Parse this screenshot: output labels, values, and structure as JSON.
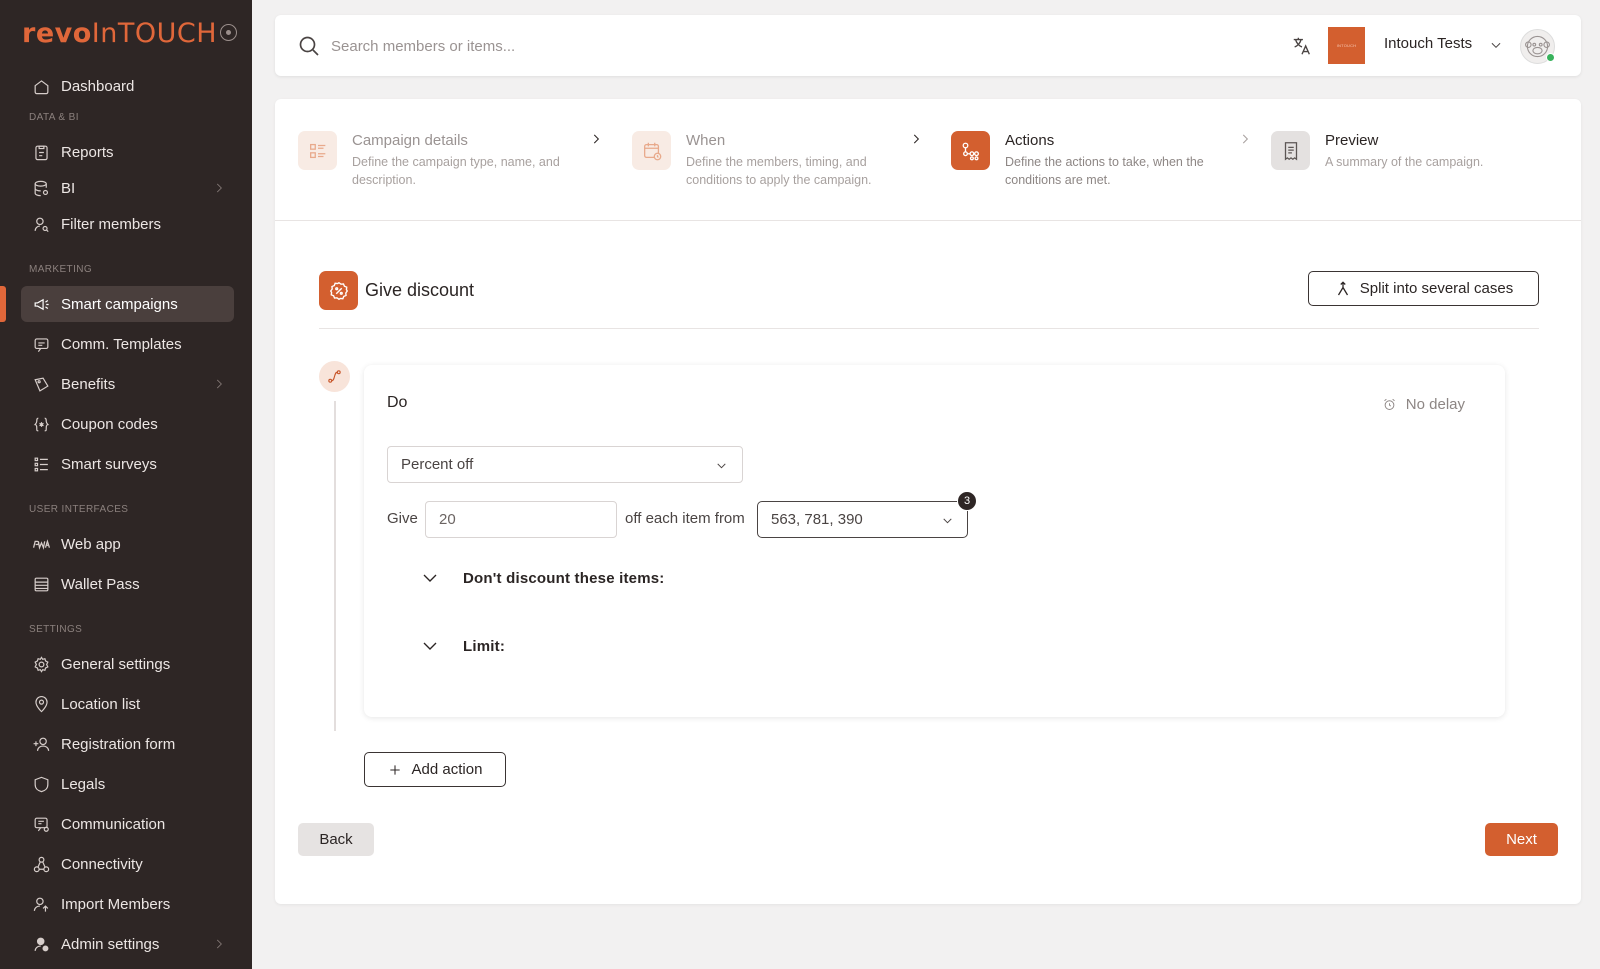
{
  "brand": {
    "logo_bold": "revo",
    "logo_light": "InTOUCH"
  },
  "sidebar": {
    "items": [
      {
        "label": "Dashboard"
      },
      {
        "section": "DATA & BI"
      },
      {
        "label": "Reports"
      },
      {
        "label": "BI"
      },
      {
        "label": "Filter members"
      },
      {
        "section": "MARKETING"
      },
      {
        "label": "Smart campaigns"
      },
      {
        "label": "Comm. Templates"
      },
      {
        "label": "Benefits"
      },
      {
        "label": "Coupon codes"
      },
      {
        "label": "Smart surveys"
      },
      {
        "section": "USER INTERFACES"
      },
      {
        "label": "Web app"
      },
      {
        "label": "Wallet Pass"
      },
      {
        "section": "SETTINGS"
      },
      {
        "label": "General settings"
      },
      {
        "label": "Location list"
      },
      {
        "label": "Registration form"
      },
      {
        "label": "Legals"
      },
      {
        "label": "Communication"
      },
      {
        "label": "Connectivity"
      },
      {
        "label": "Import Members"
      },
      {
        "label": "Admin settings"
      }
    ]
  },
  "topbar": {
    "search_placeholder": "Search members or items...",
    "org_logo_text": "INTOUCH",
    "org_name": "Intouch Tests"
  },
  "steps": [
    {
      "title": "Campaign details",
      "desc": "Define the campaign type, name, and description."
    },
    {
      "title": "When",
      "desc": "Define the members, timing, and conditions to apply the campaign."
    },
    {
      "title": "Actions",
      "desc": "Define the actions to take, when the conditions are met."
    },
    {
      "title": "Preview",
      "desc": "A summary of the campaign."
    }
  ],
  "section": {
    "title": "Give discount",
    "split_label": "Split into several cases"
  },
  "do_card": {
    "title": "Do",
    "delay_label": "No delay",
    "discount_type": "Percent off",
    "give_label": "Give",
    "give_value": "20",
    "off_label": "off each item from",
    "items_value": "563, 781, 390",
    "items_count": "3",
    "exclude_label": "Don't discount these items:",
    "limit_label": "Limit:"
  },
  "actions": {
    "add_action": "Add action",
    "back": "Back",
    "next": "Next"
  },
  "colors": {
    "accent": "#d35f2f",
    "sidebar_bg": "#2e2625",
    "status_online": "#38b25c"
  }
}
